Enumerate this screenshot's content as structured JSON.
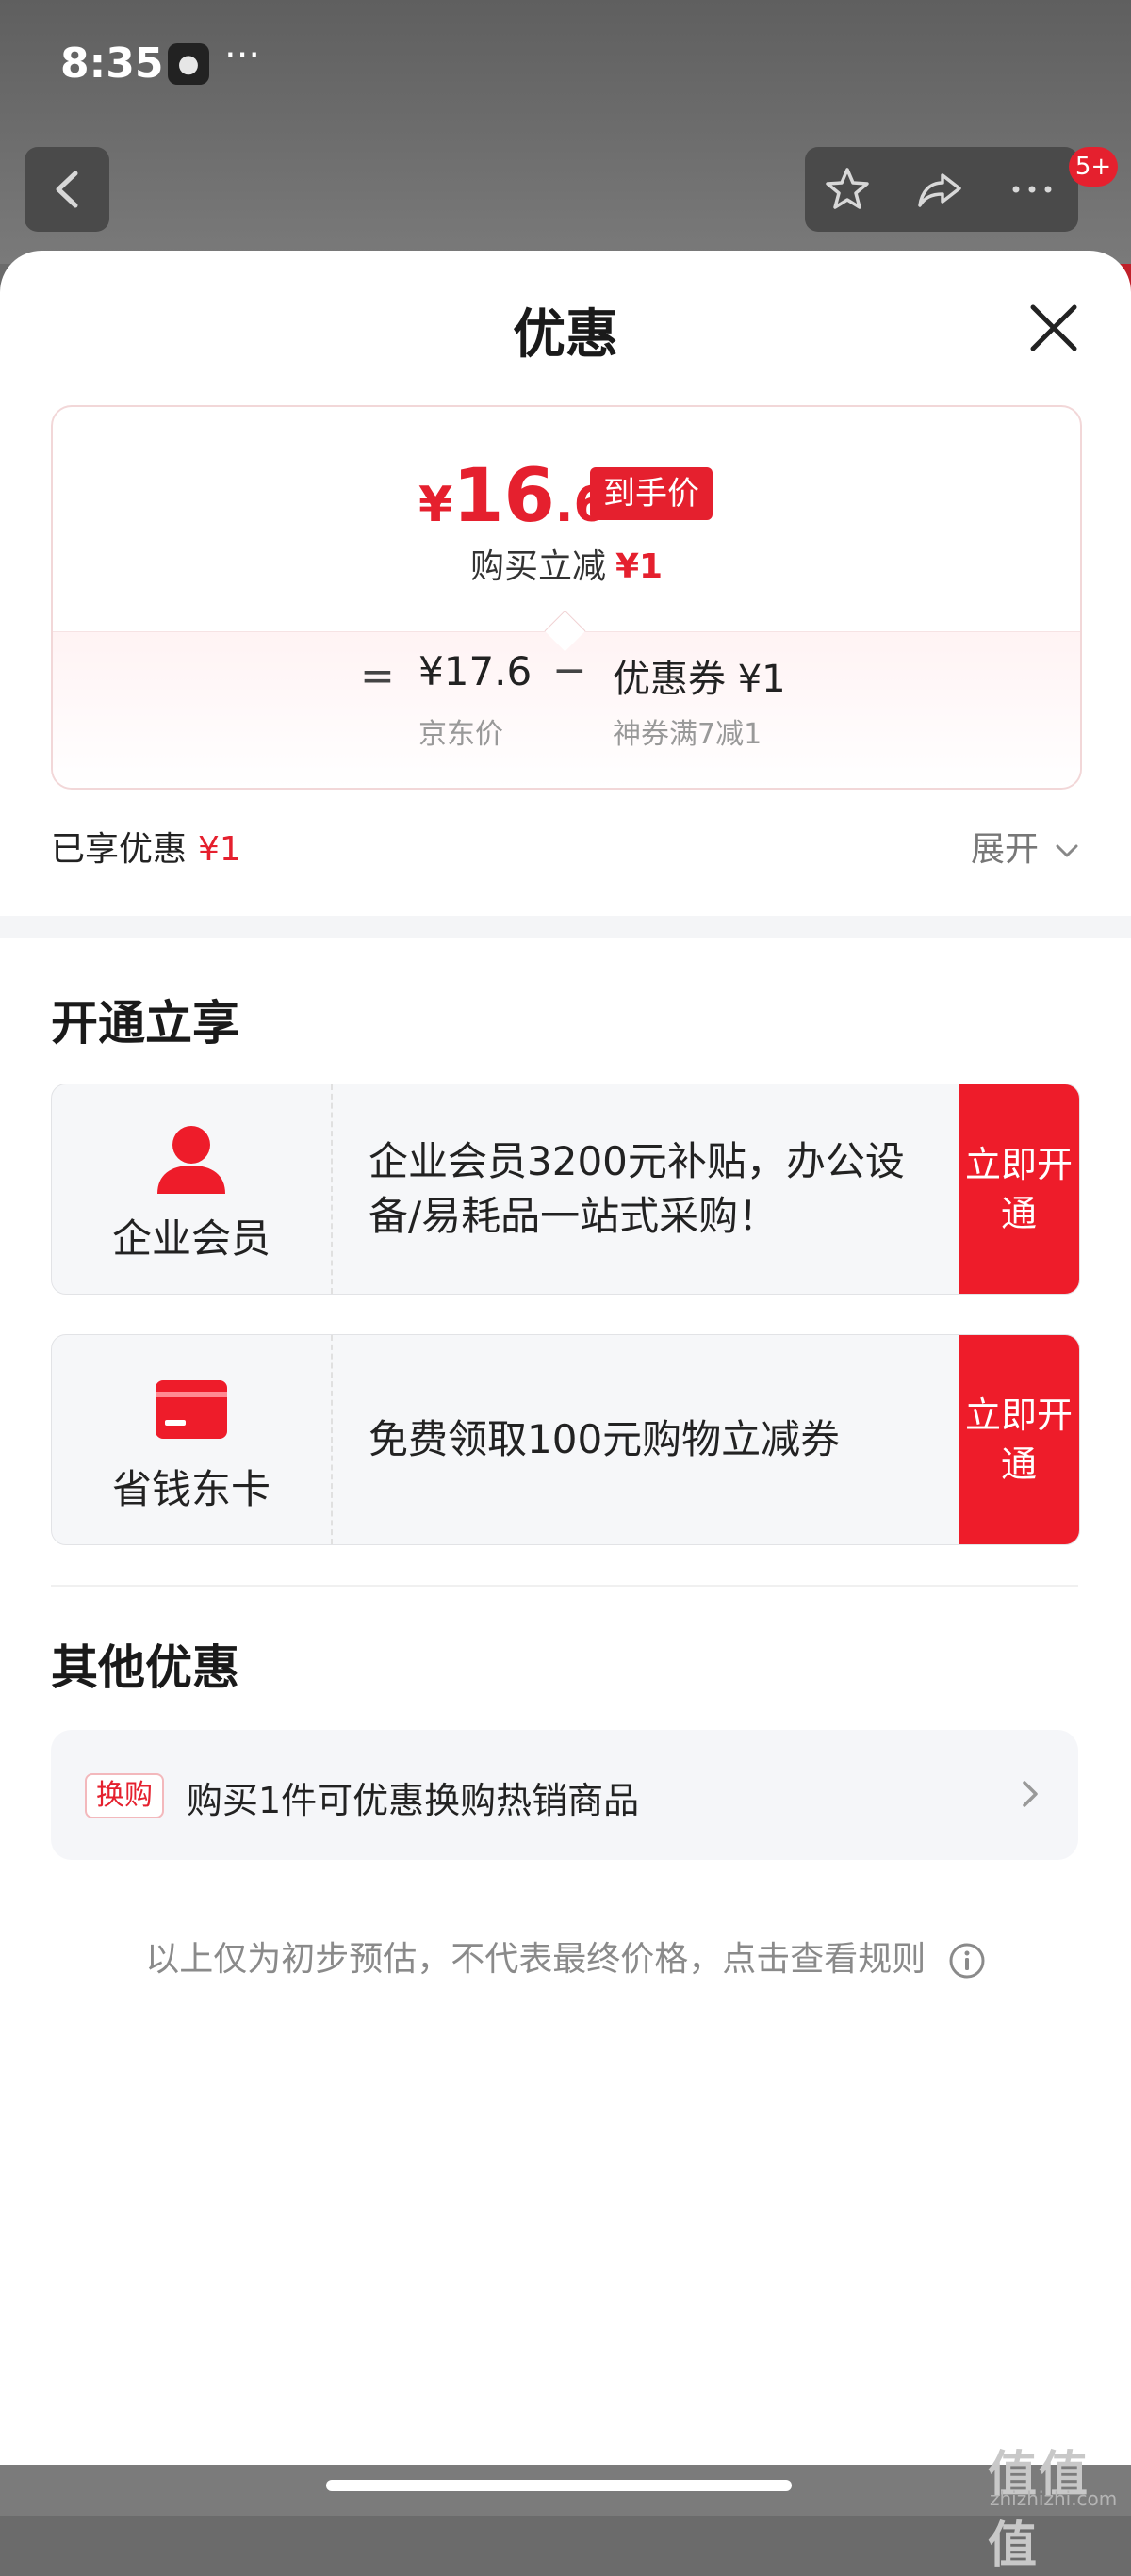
{
  "status_bar": {
    "time": "8:35",
    "more": "···"
  },
  "top_bar": {
    "cart_badge": "5+"
  },
  "sheet": {
    "title": "优惠",
    "price_card": {
      "yen": "¥",
      "price_int": "16",
      "price_dec": ".6",
      "final_price_tag": "到手价",
      "buy_reduce_label": "购买立减",
      "buy_reduce_value": "¥1",
      "equals": "=",
      "jd_price": "¥17.6",
      "jd_price_label": "京东价",
      "minus": "−",
      "coupon": "优惠券 ¥1",
      "coupon_label": "神券满7减1"
    },
    "enjoyed_label": "已享优惠",
    "enjoyed_value": "¥1",
    "expand_label": "展开"
  },
  "open_section": {
    "title": "开通立享",
    "cards": [
      {
        "name": "企业会员",
        "desc": "企业会员3200元补贴，办公设备/易耗品一站式采购！",
        "cta": "立即开通"
      },
      {
        "name": "省钱东卡",
        "desc": "免费领取100元购物立减券",
        "cta": "立即开通"
      }
    ]
  },
  "other_section": {
    "title": "其他优惠",
    "row_tag": "换购",
    "row_text": "购买1件可优惠换购热销商品"
  },
  "disclaimer": "以上仅为初步预估，不代表最终价格，点击查看规则",
  "watermark": {
    "logo": "值值值",
    "url": "zhizhizhi.com"
  },
  "colors": {
    "accent": "#e5202e",
    "cta": "#ee1c2a"
  }
}
